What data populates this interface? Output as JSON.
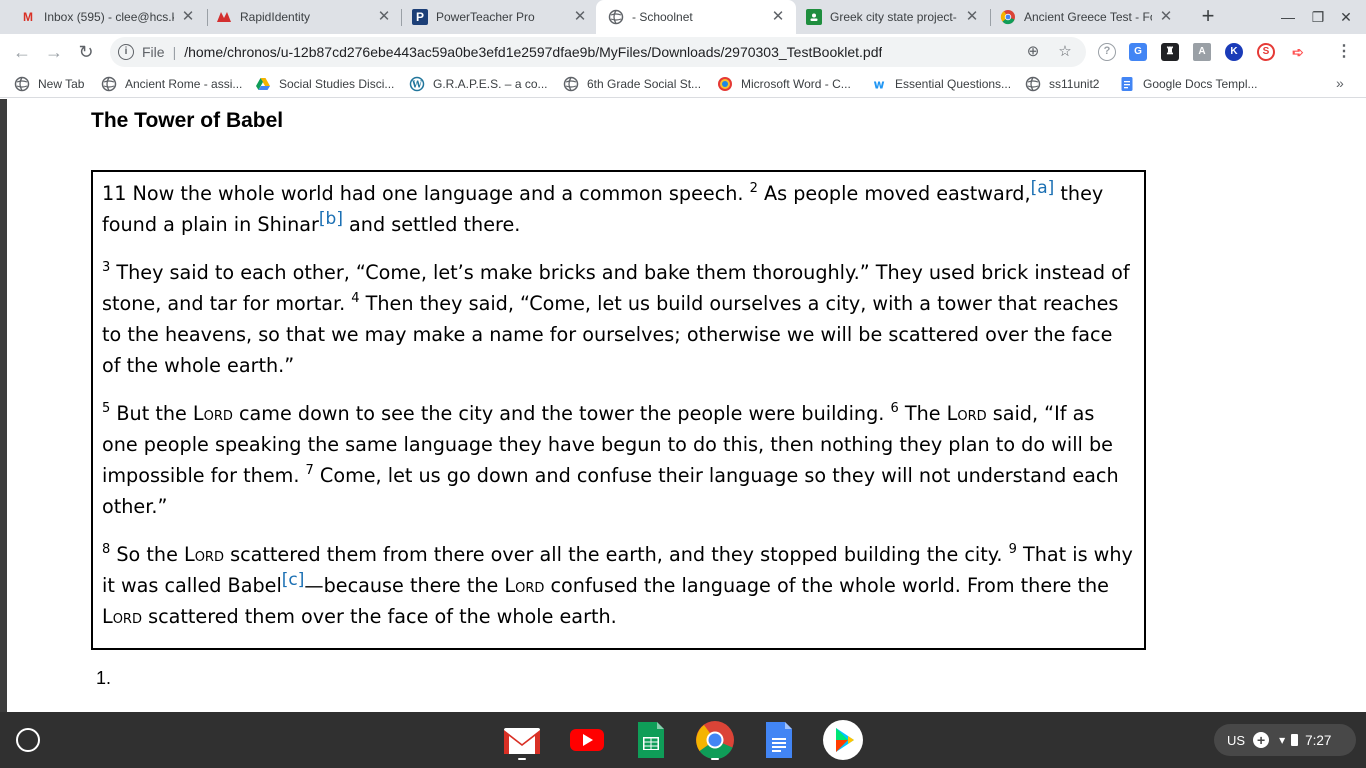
{
  "tabs": [
    {
      "title": "Inbox (595) - clee@hcs.k",
      "icon": "gmail-icon",
      "active": false
    },
    {
      "title": "RapidIdentity",
      "icon": "rapididentity-icon",
      "active": false
    },
    {
      "title": "PowerTeacher Pro",
      "icon": "powerschool-icon",
      "active": false
    },
    {
      "title": "- Schoolnet",
      "icon": "globe-icon",
      "active": true
    },
    {
      "title": "Greek city state project- V",
      "icon": "classroom-icon",
      "active": false
    },
    {
      "title": "Ancient Greece Test - For",
      "icon": "chrome-icon",
      "active": false
    }
  ],
  "toolbar": {
    "scheme": "File",
    "url": "/home/chronos/u-12b87cd276ebe443ac59a0be3efd1e2597dfae9b/MyFiles/Downloads/2970303_TestBooklet.pdf"
  },
  "bookmarks": [
    {
      "label": "New Tab",
      "icon": "globe-icon"
    },
    {
      "label": "Ancient Rome - assi...",
      "icon": "globe-icon"
    },
    {
      "label": "Social Studies Disci...",
      "icon": "drive-icon"
    },
    {
      "label": "G.R.A.P.E.S. – a co...",
      "icon": "wordpress-icon"
    },
    {
      "label": "6th Grade Social St...",
      "icon": "globe-icon"
    },
    {
      "label": "Microsoft Word - C...",
      "icon": "colorful-globe-icon"
    },
    {
      "label": "Essential Questions...",
      "icon": "weebly-icon"
    },
    {
      "label": "ss11unit2",
      "icon": "globe-icon"
    },
    {
      "label": "Google Docs Templ...",
      "icon": "docs-icon"
    }
  ],
  "document": {
    "title": "The Tower of Babel",
    "p1": {
      "n11": "11",
      "a": " Now the whole world had one language and a common speech. ",
      "n2": "2",
      "b": " As people moved eastward,",
      "fa": "[a]",
      "c": " they found a plain in Shinar",
      "fb": "[b]",
      "d": " and settled there."
    },
    "p2": {
      "n3": "3",
      "a": " They said to each other, “Come, let’s make bricks and bake them thoroughly.” They used brick instead of stone, and tar for mortar. ",
      "n4": "4",
      "b": " Then they said, “Come, let us build ourselves a city, with a tower that reaches to the heavens, so that we may make a name for ourselves; otherwise we will be scattered over the face of the whole earth.”"
    },
    "p3": {
      "n5": "5",
      "a": " But the ",
      "lord1": "Lord",
      "b": " came down to see the city and the tower the people were building. ",
      "n6": "6",
      "c": " The ",
      "lord2": "Lord",
      "d": " said, “If as one people speaking the same language they have begun to do this, then nothing they plan to do will be impossible for them. ",
      "n7": "7",
      "e": " Come, let us go down and confuse their language so they will not understand each other.”"
    },
    "p4": {
      "n8": "8",
      "a": " So the ",
      "lord1": "Lord",
      "b": " scattered them from there over all the earth, and they stopped building the city. ",
      "n9": "9",
      "c": " That is why it was called Babel",
      "fc": "[c]",
      "d": "—because there the ",
      "lord2": "Lord",
      "e": " confused the language of the whole world. From there the ",
      "lord3": "Lord",
      "f": " scattered them over the face of the whole earth."
    },
    "question_number": "1."
  },
  "shelf": {
    "apps": [
      "gmail-icon",
      "youtube-icon",
      "sheets-icon",
      "chrome-icon",
      "docs-icon",
      "play-store-icon"
    ],
    "locale": "US",
    "time": "7:27"
  }
}
